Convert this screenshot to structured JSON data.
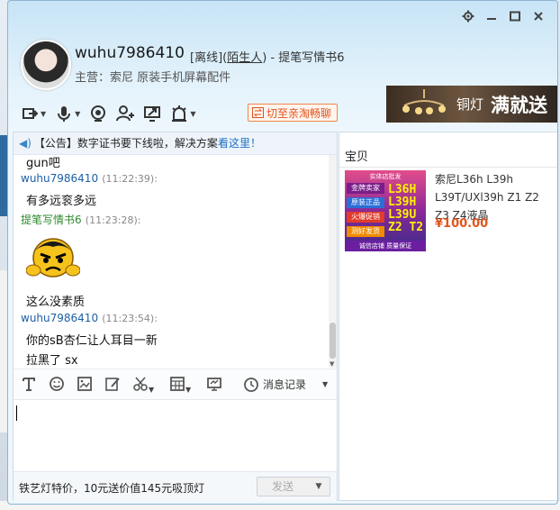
{
  "window": {
    "controls": [
      "settings",
      "minimize",
      "maximize",
      "close"
    ]
  },
  "header": {
    "username": "wuhu7986410",
    "status_prefix": "[离线](",
    "status_link": "陌生人",
    "status_suffix": ") - 提笔写情书6",
    "shop": "主营：索尼 原装手机屏幕配件",
    "switch_label": "切至亲淘畅聊"
  },
  "ad": {
    "small": "铜灯",
    "big": "满就送"
  },
  "notice": {
    "prefix": "【公告】数字证书要下线啦，解决方案",
    "link": "看这里！"
  },
  "messages": [
    {
      "type": "text",
      "text": "gun吧"
    },
    {
      "type": "sender",
      "sender": "wuhu7986410",
      "time": "(11:22:39):",
      "me": true
    },
    {
      "type": "text",
      "text": "有多远衮多远"
    },
    {
      "type": "sender",
      "sender": "提笔写情书6",
      "time": "(11:23:28):",
      "me": false
    },
    {
      "type": "emoji",
      "name": "angry-emoji"
    },
    {
      "type": "text",
      "text": "这么没素质"
    },
    {
      "type": "sender",
      "sender": "wuhu7986410",
      "time": "(11:23:54):",
      "me": true
    },
    {
      "type": "text",
      "text": "你的sB杏仁让人耳目一新"
    },
    {
      "type": "text",
      "text": "拉黑了 sx"
    }
  ],
  "tools": {
    "history_label": "消息记录"
  },
  "footer": {
    "promo": "铁艺灯特价，10元送价值145元吸顶灯",
    "send_label": "发送"
  },
  "side": {
    "title": "宝贝",
    "product_name": "索尼L36h L39h L39T/UXl39h Z1 Z2 Z3 Z4液晶",
    "price": "¥100.00",
    "img_models": [
      "L36H",
      "L39H",
      "L39U",
      "Z2 T2"
    ],
    "img_tags": [
      "金牌卖家",
      "原装正品",
      "火爆促销",
      "测好发货"
    ],
    "img_top": "实体店批发",
    "img_foot": "诚信店铺 质量保证"
  },
  "colors": {
    "accent": "#1d6ec1",
    "price": "#e4541c",
    "switch": "#e2531a",
    "other_sender": "#2f8a2f"
  }
}
